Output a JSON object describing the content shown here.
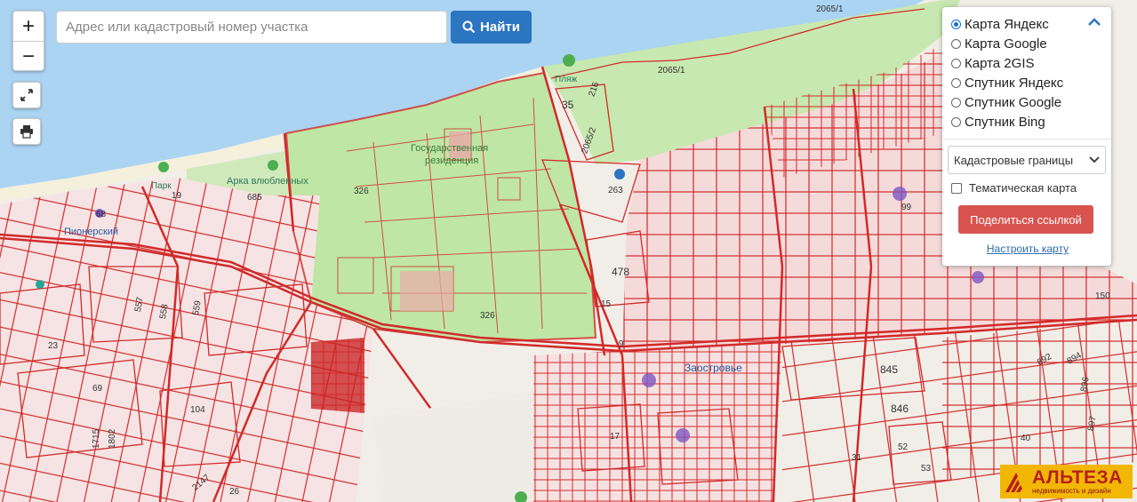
{
  "search": {
    "placeholder": "Адрес или кадастровый номер участка",
    "button_label": "Найти"
  },
  "zoom": {
    "in_label": "+",
    "out_label": "−"
  },
  "layers": {
    "options": [
      "Карта Яндекс",
      "Карта Google",
      "Карта 2GIS",
      "Спутник Яндекс",
      "Спутник Google",
      "Спутник Bing"
    ],
    "selected_index": 0,
    "overlay_select": "Кадастровые границы",
    "thematic_label": "Тематическая карта",
    "thematic_checked": false,
    "share_label": "Поделиться ссылкой",
    "configure_label": "Настроить карту"
  },
  "map_labels": {
    "parcel_2065_1_top": "2065/1",
    "parcel_2065_1": "2065/1",
    "parcel_216": "216",
    "parcel_35": "35",
    "parcel_2065_2": "2065/2",
    "parcel_263": "263",
    "parcel_326_a": "326",
    "parcel_326_b": "326",
    "parcel_685": "685",
    "parcel_478": "478",
    "parcel_15": "15",
    "parcel_9": "9",
    "parcel_845": "845",
    "parcel_846": "846",
    "parcel_150": "150",
    "parcel_68": "68",
    "parcel_19": "19",
    "parcel_557": "557",
    "parcel_558": "558",
    "parcel_559": "559",
    "parcel_23": "23",
    "parcel_69": "69",
    "parcel_104": "104",
    "parcel_1715": "1715",
    "parcel_1802": "1802",
    "parcel_2147": "2147",
    "parcel_26": "26",
    "parcel_17": "17",
    "parcel_31": "31",
    "parcel_52": "52",
    "parcel_53": "53",
    "parcel_892": "892",
    "parcel_894": "894",
    "parcel_896": "896",
    "parcel_897": "897",
    "parcel_40": "40",
    "parcel_99": "99",
    "place_arka": "Арка влюбленных",
    "place_gos": "Государственная",
    "place_rez": "резиденция",
    "place_pioner": "Пионерский",
    "place_zaostrovye": "Заостровье",
    "place_plyazh": "Пляж",
    "place_park": "Парк"
  },
  "logo": {
    "brand": "АЛЬТЕЗА",
    "tagline": "недвижимость и дизайн"
  },
  "colors": {
    "accent": "#2b75c1",
    "share": "#d9534f",
    "parcel": "#d22a2a",
    "water": "#abd3f2",
    "park": "#bfe6a4"
  }
}
